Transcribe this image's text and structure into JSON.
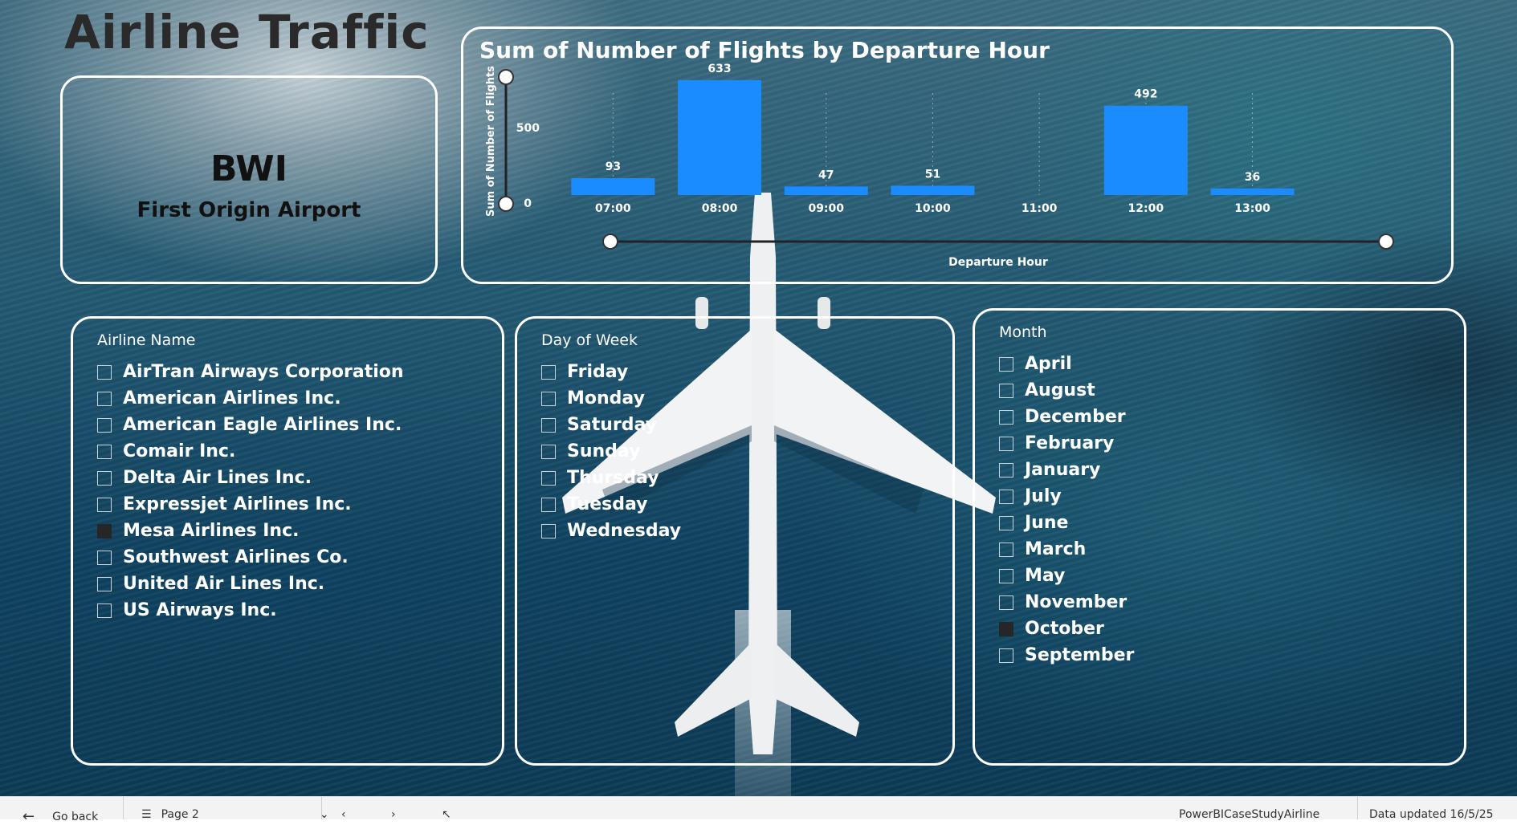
{
  "app": {
    "title": "Airline Traffic"
  },
  "card": {
    "value": "BWI",
    "label": "First Origin Airport"
  },
  "chart_data": {
    "type": "bar",
    "title": "Sum of Number of Flights by Departure Hour",
    "xlabel": "Departure Hour",
    "ylabel": "Sum of Number of Flights",
    "categories": [
      "07:00",
      "08:00",
      "09:00",
      "10:00",
      "11:00",
      "12:00",
      "13:00"
    ],
    "values": [
      93,
      633,
      47,
      51,
      null,
      492,
      36
    ],
    "yticks": [
      "500",
      "0"
    ],
    "ylim": [
      0,
      650
    ],
    "bar_color": "#1a8cff"
  },
  "slicers": {
    "airline": {
      "title": "Airline Name",
      "items": [
        {
          "label": "AirTran Airways Corporation",
          "checked": false
        },
        {
          "label": "American Airlines Inc.",
          "checked": false
        },
        {
          "label": "American Eagle Airlines Inc.",
          "checked": false
        },
        {
          "label": "Comair Inc.",
          "checked": false
        },
        {
          "label": "Delta Air Lines Inc.",
          "checked": false
        },
        {
          "label": "Expressjet Airlines Inc.",
          "checked": false
        },
        {
          "label": "Mesa Airlines Inc.",
          "checked": true
        },
        {
          "label": "Southwest Airlines Co.",
          "checked": false
        },
        {
          "label": "United Air Lines Inc.",
          "checked": false
        },
        {
          "label": "US Airways Inc.",
          "checked": false
        }
      ]
    },
    "day": {
      "title": "Day of Week",
      "items": [
        {
          "label": "Friday",
          "checked": false
        },
        {
          "label": "Monday",
          "checked": false
        },
        {
          "label": "Saturday",
          "checked": false
        },
        {
          "label": "Sunday",
          "checked": false
        },
        {
          "label": "Thursday",
          "checked": false
        },
        {
          "label": "Tuesday",
          "checked": false
        },
        {
          "label": "Wednesday",
          "checked": false
        }
      ]
    },
    "month": {
      "title": "Month",
      "items": [
        {
          "label": "April",
          "checked": false
        },
        {
          "label": "August",
          "checked": false
        },
        {
          "label": "December",
          "checked": false
        },
        {
          "label": "February",
          "checked": false
        },
        {
          "label": "January",
          "checked": false
        },
        {
          "label": "July",
          "checked": false
        },
        {
          "label": "June",
          "checked": false
        },
        {
          "label": "March",
          "checked": false
        },
        {
          "label": "May",
          "checked": false
        },
        {
          "label": "November",
          "checked": false
        },
        {
          "label": "October",
          "checked": true
        },
        {
          "label": "September",
          "checked": false
        }
      ]
    }
  },
  "statusbar": {
    "go_back": "Go back",
    "page": "Page 2",
    "report_name": "PowerBICaseStudyAirline",
    "data_updated": "Data updated 16/5/25"
  }
}
